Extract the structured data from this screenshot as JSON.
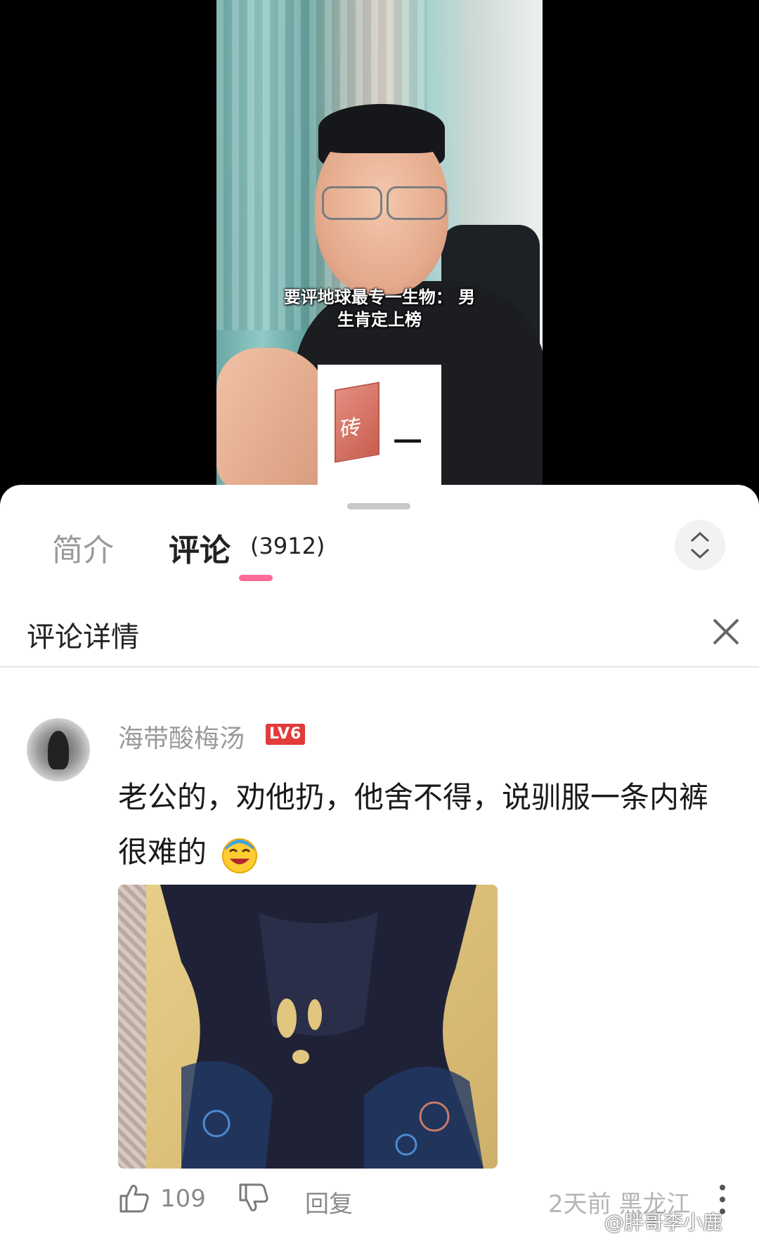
{
  "video": {
    "subtitle_line1": "要评地球最专一生物： 男",
    "subtitle_line2": "生肯定上榜",
    "brick_label": "砖",
    "brick_dash": "一"
  },
  "tabs": {
    "intro_label": "简介",
    "comments_label": "评论",
    "comments_count": "(3912)",
    "active_color": "#ff6a99"
  },
  "header": {
    "title": "评论详情"
  },
  "comment": {
    "username": "海带酸梅汤",
    "level_badge": "LV6",
    "text": "老公的，劝他扔，他舍不得，说驯服一条内裤很难的",
    "emoji_icon": "laughing-crying-emoji-icon",
    "likes": "109",
    "reply_label": "回复",
    "timestamp_location": "2天前 黑龙江"
  },
  "watermark": "@胖哥李小鹿",
  "icons": [
    "chevron-updown-icon",
    "close-icon",
    "thumbs-up-icon",
    "thumbs-down-icon",
    "more-vertical-icon"
  ]
}
